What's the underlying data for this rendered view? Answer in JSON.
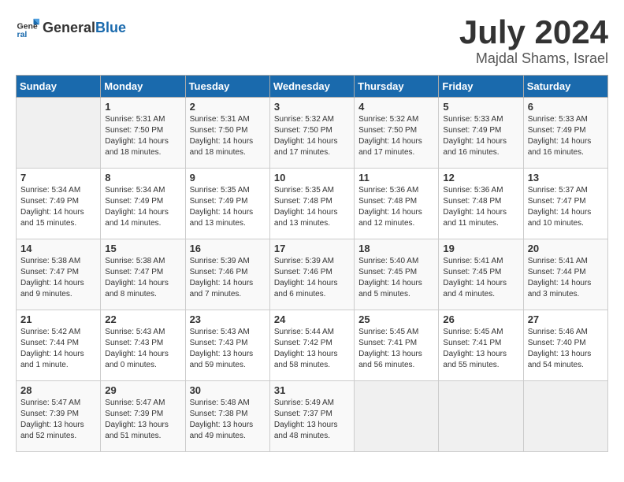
{
  "header": {
    "logo": {
      "general": "General",
      "blue": "Blue"
    },
    "month": "July 2024",
    "location": "Majdal Shams, Israel"
  },
  "weekdays": [
    "Sunday",
    "Monday",
    "Tuesday",
    "Wednesday",
    "Thursday",
    "Friday",
    "Saturday"
  ],
  "weeks": [
    [
      {
        "day": "",
        "info": ""
      },
      {
        "day": "1",
        "info": "Sunrise: 5:31 AM\nSunset: 7:50 PM\nDaylight: 14 hours\nand 18 minutes."
      },
      {
        "day": "2",
        "info": "Sunrise: 5:31 AM\nSunset: 7:50 PM\nDaylight: 14 hours\nand 18 minutes."
      },
      {
        "day": "3",
        "info": "Sunrise: 5:32 AM\nSunset: 7:50 PM\nDaylight: 14 hours\nand 17 minutes."
      },
      {
        "day": "4",
        "info": "Sunrise: 5:32 AM\nSunset: 7:50 PM\nDaylight: 14 hours\nand 17 minutes."
      },
      {
        "day": "5",
        "info": "Sunrise: 5:33 AM\nSunset: 7:49 PM\nDaylight: 14 hours\nand 16 minutes."
      },
      {
        "day": "6",
        "info": "Sunrise: 5:33 AM\nSunset: 7:49 PM\nDaylight: 14 hours\nand 16 minutes."
      }
    ],
    [
      {
        "day": "7",
        "info": "Sunrise: 5:34 AM\nSunset: 7:49 PM\nDaylight: 14 hours\nand 15 minutes."
      },
      {
        "day": "8",
        "info": "Sunrise: 5:34 AM\nSunset: 7:49 PM\nDaylight: 14 hours\nand 14 minutes."
      },
      {
        "day": "9",
        "info": "Sunrise: 5:35 AM\nSunset: 7:49 PM\nDaylight: 14 hours\nand 13 minutes."
      },
      {
        "day": "10",
        "info": "Sunrise: 5:35 AM\nSunset: 7:48 PM\nDaylight: 14 hours\nand 13 minutes."
      },
      {
        "day": "11",
        "info": "Sunrise: 5:36 AM\nSunset: 7:48 PM\nDaylight: 14 hours\nand 12 minutes."
      },
      {
        "day": "12",
        "info": "Sunrise: 5:36 AM\nSunset: 7:48 PM\nDaylight: 14 hours\nand 11 minutes."
      },
      {
        "day": "13",
        "info": "Sunrise: 5:37 AM\nSunset: 7:47 PM\nDaylight: 14 hours\nand 10 minutes."
      }
    ],
    [
      {
        "day": "14",
        "info": "Sunrise: 5:38 AM\nSunset: 7:47 PM\nDaylight: 14 hours\nand 9 minutes."
      },
      {
        "day": "15",
        "info": "Sunrise: 5:38 AM\nSunset: 7:47 PM\nDaylight: 14 hours\nand 8 minutes."
      },
      {
        "day": "16",
        "info": "Sunrise: 5:39 AM\nSunset: 7:46 PM\nDaylight: 14 hours\nand 7 minutes."
      },
      {
        "day": "17",
        "info": "Sunrise: 5:39 AM\nSunset: 7:46 PM\nDaylight: 14 hours\nand 6 minutes."
      },
      {
        "day": "18",
        "info": "Sunrise: 5:40 AM\nSunset: 7:45 PM\nDaylight: 14 hours\nand 5 minutes."
      },
      {
        "day": "19",
        "info": "Sunrise: 5:41 AM\nSunset: 7:45 PM\nDaylight: 14 hours\nand 4 minutes."
      },
      {
        "day": "20",
        "info": "Sunrise: 5:41 AM\nSunset: 7:44 PM\nDaylight: 14 hours\nand 3 minutes."
      }
    ],
    [
      {
        "day": "21",
        "info": "Sunrise: 5:42 AM\nSunset: 7:44 PM\nDaylight: 14 hours\nand 1 minute."
      },
      {
        "day": "22",
        "info": "Sunrise: 5:43 AM\nSunset: 7:43 PM\nDaylight: 14 hours\nand 0 minutes."
      },
      {
        "day": "23",
        "info": "Sunrise: 5:43 AM\nSunset: 7:43 PM\nDaylight: 13 hours\nand 59 minutes."
      },
      {
        "day": "24",
        "info": "Sunrise: 5:44 AM\nSunset: 7:42 PM\nDaylight: 13 hours\nand 58 minutes."
      },
      {
        "day": "25",
        "info": "Sunrise: 5:45 AM\nSunset: 7:41 PM\nDaylight: 13 hours\nand 56 minutes."
      },
      {
        "day": "26",
        "info": "Sunrise: 5:45 AM\nSunset: 7:41 PM\nDaylight: 13 hours\nand 55 minutes."
      },
      {
        "day": "27",
        "info": "Sunrise: 5:46 AM\nSunset: 7:40 PM\nDaylight: 13 hours\nand 54 minutes."
      }
    ],
    [
      {
        "day": "28",
        "info": "Sunrise: 5:47 AM\nSunset: 7:39 PM\nDaylight: 13 hours\nand 52 minutes."
      },
      {
        "day": "29",
        "info": "Sunrise: 5:47 AM\nSunset: 7:39 PM\nDaylight: 13 hours\nand 51 minutes."
      },
      {
        "day": "30",
        "info": "Sunrise: 5:48 AM\nSunset: 7:38 PM\nDaylight: 13 hours\nand 49 minutes."
      },
      {
        "day": "31",
        "info": "Sunrise: 5:49 AM\nSunset: 7:37 PM\nDaylight: 13 hours\nand 48 minutes."
      },
      {
        "day": "",
        "info": ""
      },
      {
        "day": "",
        "info": ""
      },
      {
        "day": "",
        "info": ""
      }
    ]
  ]
}
